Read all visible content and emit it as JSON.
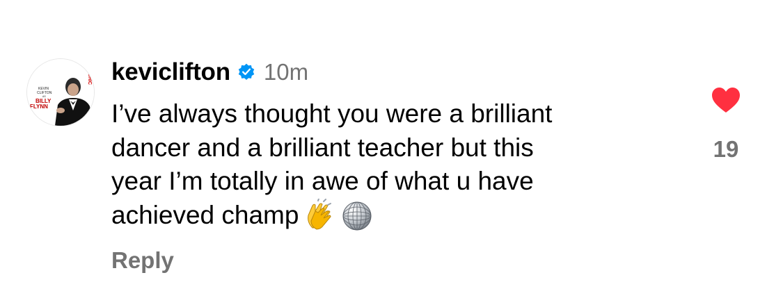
{
  "comment": {
    "avatar": {
      "icon": "avatar-kevin-clifton-billy-flynn",
      "text_top": "KEVIN",
      "text_mid": "CLIFTON",
      "text_small": "AS",
      "text_name1": "BILLY",
      "text_name2": "FLYNN",
      "text_side": "CHIC"
    },
    "username": "keviclifton",
    "verified_icon": "verified-badge-icon",
    "timestamp": "10m",
    "text_lines": [
      "I’ve always thought you were a brilliant",
      "dancer and a brilliant teacher but this",
      "year I’m totally in awe of what u have",
      "achieved champ"
    ],
    "emojis": [
      "clapping-hands-icon",
      "mirror-ball-icon"
    ],
    "reply_label": "Reply",
    "like": {
      "icon": "heart-icon",
      "liked": true,
      "count": "19"
    }
  },
  "colors": {
    "text": "#000000",
    "secondary": "#737373",
    "heart": "#ff3040",
    "verified": "#0095f6",
    "background": "#ffffff"
  }
}
